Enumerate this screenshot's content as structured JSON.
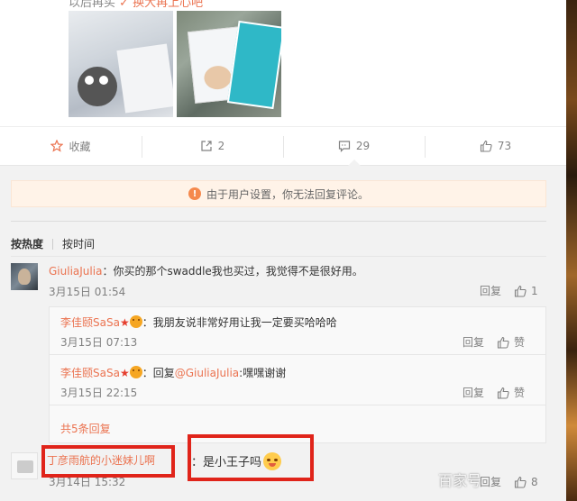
{
  "post": {
    "text_prefix": "以后再买",
    "text_suffix": "✓ 换大再上心吧"
  },
  "actions": [
    {
      "label": "收藏",
      "icon": "star-icon"
    },
    {
      "label": "2",
      "icon": "share-icon"
    },
    {
      "label": "29",
      "icon": "comment-icon"
    },
    {
      "label": "73",
      "icon": "thumbs-up-icon"
    }
  ],
  "notice": "由于用户设置，你无法回复评论。",
  "sort": {
    "hot": "按热度",
    "time": "按时间"
  },
  "comments": [
    {
      "user": "GiuliaJulia",
      "text": "：你买的那个swaddle我也买过，我觉得不是很好用。",
      "time": "3月15日 01:54",
      "reply_label": "回复",
      "like_count": "1"
    },
    {
      "user": "丁彦雨航的小迷妹儿啊",
      "text": "：是小王子吗",
      "time": "3月14日 15:32",
      "reply_label": "回复",
      "like_count": "8"
    }
  ],
  "replies": [
    {
      "user": "李佳颐SaSa",
      "text": "：我朋友说非常好用让我一定要买哈哈哈",
      "time": "3月15日 07:13",
      "reply_label": "回复",
      "like_label": "赞"
    },
    {
      "user": "李佳颐SaSa",
      "reply_prefix": "：回复",
      "at_user": "@GiuliaJulia",
      "text": ":嘿嘿谢谢",
      "time": "3月15日 22:15",
      "reply_label": "回复",
      "like_label": "赞"
    }
  ],
  "more_replies": "共5条回复",
  "watermark": "百家号"
}
